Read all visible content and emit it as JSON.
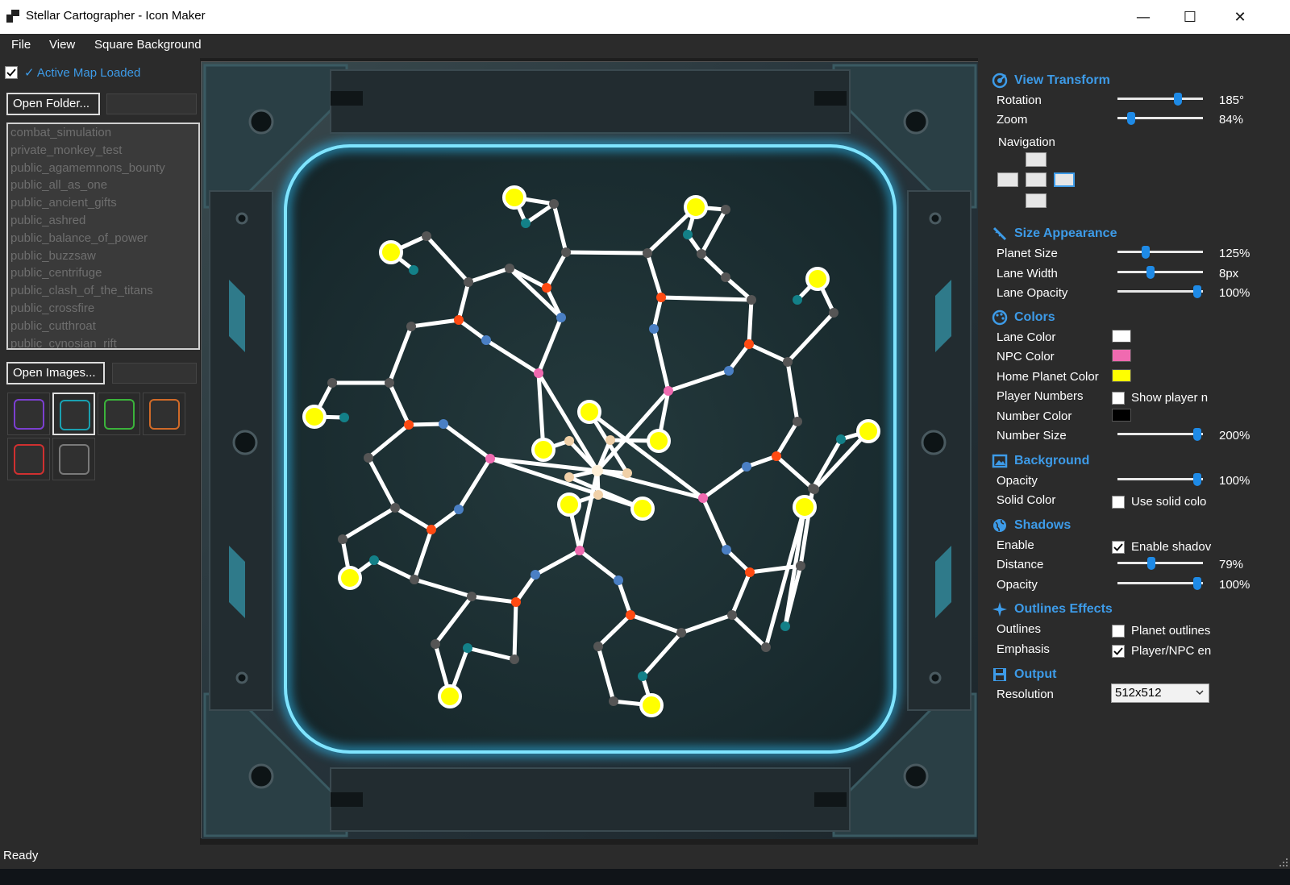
{
  "window": {
    "title": "Stellar Cartographer - Icon Maker",
    "minimize": "—",
    "maximize": "☐",
    "close": "✕"
  },
  "menu": [
    "File",
    "View",
    "Square Background"
  ],
  "left": {
    "active_map_label": "✓ Active Map Loaded",
    "active_map_checked": true,
    "open_folder_label": "Open Folder...",
    "open_images_label": "Open Images...",
    "maps": [
      "combat_simulation",
      "private_monkey_test",
      "public_agamemnons_bounty",
      "public_all_as_one",
      "public_ancient_gifts",
      "public_ashred",
      "public_balance_of_power",
      "public_buzzsaw",
      "public_centrifuge",
      "public_clash_of_the_titans",
      "public_crossfire",
      "public_cutthroat",
      "public_cynosian_rift"
    ],
    "swatches": [
      {
        "name": "purple",
        "color": "#7b3fd0"
      },
      {
        "name": "teal",
        "color": "#1aa0b0"
      },
      {
        "name": "green",
        "color": "#3bb33b"
      },
      {
        "name": "orange",
        "color": "#d06a28"
      },
      {
        "name": "red",
        "color": "#d03030"
      },
      {
        "name": "gray",
        "color": "#7a7a7a"
      }
    ]
  },
  "right": {
    "view_transform": {
      "title": "View  Transform",
      "rotation_label": "Rotation",
      "rotation_value": "185°",
      "rotation_frac": 0.73,
      "zoom_label": "Zoom",
      "zoom_value": "84%",
      "zoom_frac": 0.13,
      "navigation_label": "Navigation"
    },
    "size_appearance": {
      "title": "Size  Appearance",
      "planet_size_label": "Planet Size",
      "planet_size_value": "125%",
      "planet_size_frac": 0.31,
      "lane_width_label": "Lane Width",
      "lane_width_value": "8px",
      "lane_width_frac": 0.37,
      "lane_opacity_label": "Lane Opacity",
      "lane_opacity_value": "100%",
      "lane_opacity_frac": 0.98
    },
    "colors": {
      "title": "Colors",
      "lane_color_label": "Lane Color",
      "lane_color": "#ffffff",
      "npc_color_label": "NPC Color",
      "npc_color": "#f06ab0",
      "home_planet_label": "Home Planet Color",
      "home_planet_color": "#ffff00",
      "player_numbers_label": "Player Numbers",
      "player_numbers_check": "Show player n",
      "number_color_label": "Number Color",
      "number_color": "#000000",
      "number_size_label": "Number Size",
      "number_size_value": "200%",
      "number_size_frac": 0.98
    },
    "background": {
      "title": "Background",
      "opacity_label": "Opacity",
      "opacity_value": "100%",
      "opacity_frac": 0.98,
      "solid_color_label": "Solid Color",
      "solid_color_check": "Use solid colo"
    },
    "shadows": {
      "title": "Shadows",
      "enable_label": "Enable",
      "enable_check": "Enable shadov",
      "distance_label": "Distance",
      "distance_value": "79%",
      "distance_frac": 0.39,
      "opacity_label": "Opacity",
      "opacity_value": "100%",
      "opacity_frac": 0.98
    },
    "outlines": {
      "title": "Outlines  Effects",
      "outlines_label": "Outlines",
      "outlines_check": "Planet outlines",
      "emphasis_label": "Emphasis",
      "emphasis_check": "Player/NPC en"
    },
    "output": {
      "title": "Output",
      "resolution_label": "Resolution",
      "resolution_value": "512x512"
    }
  },
  "status": "Ready",
  "accent": "#3d9be8"
}
